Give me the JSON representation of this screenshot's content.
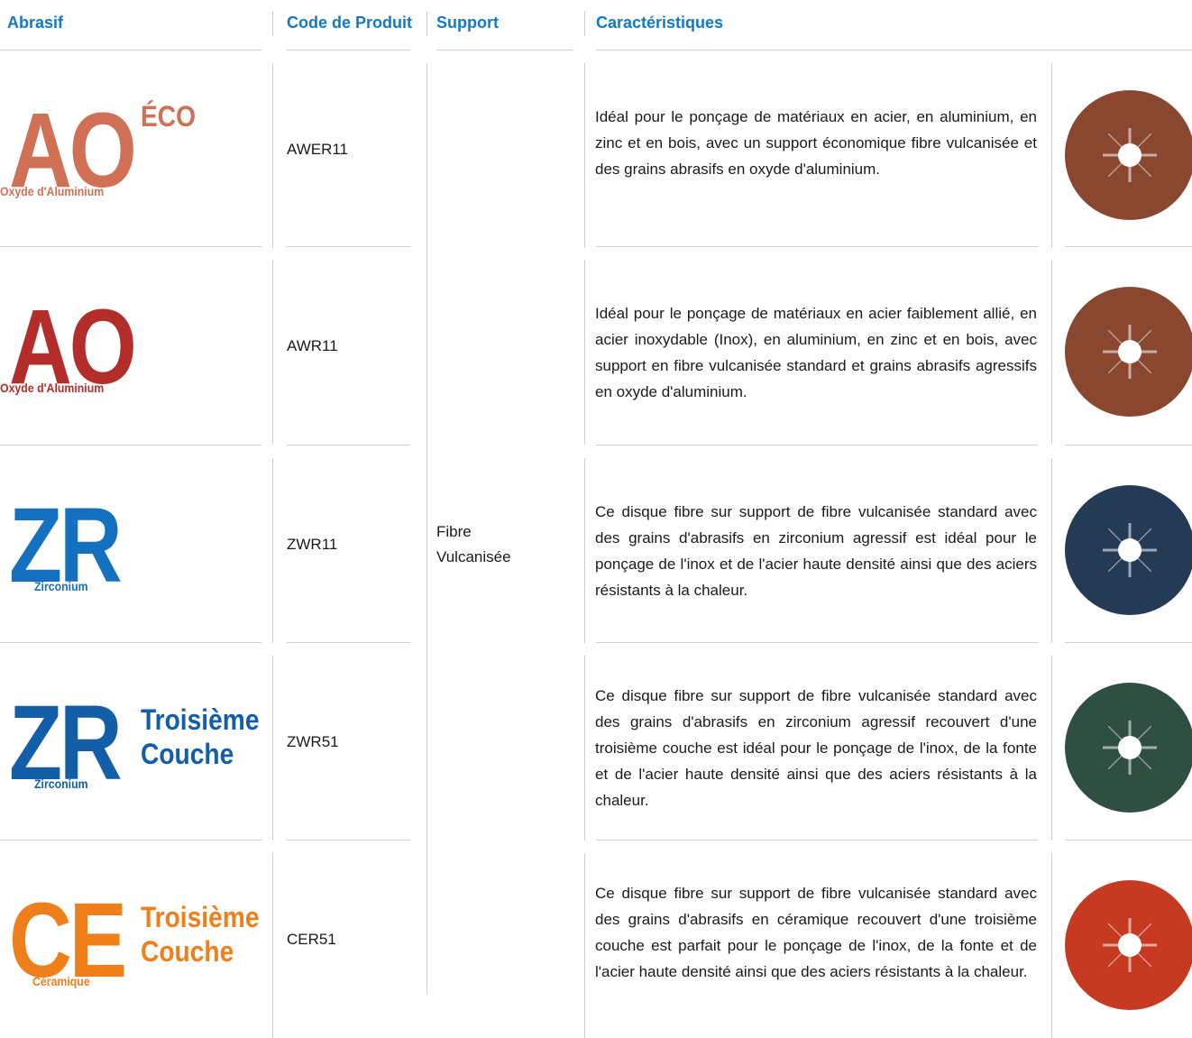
{
  "header": {
    "abrasif": "Abrasif",
    "code": "Code de Produit",
    "support": "Support",
    "caracteristiques": "Caractéristiques"
  },
  "support_value": "Fibre\nVulcanisée",
  "rows": [
    {
      "logo": "AO",
      "logo_sub": "Oxyde d'Aluminium",
      "logo_side": "ÉCO",
      "color": "#d07055",
      "code": "AWER11",
      "description": "Idéal pour le ponçage de matériaux en acier, en aluminium, en zinc et en bois, avec un support économique fibre vulcanisée et des grains abrasifs en oxyde d'aluminium.",
      "disc_color": "#8a4730"
    },
    {
      "logo": "AO",
      "logo_sub": "Oxyde d'Aluminium",
      "logo_side": "",
      "color": "#b32d2a",
      "code": "AWR11",
      "description": "Idéal pour le ponçage de matériaux en acier faiblement allié, en acier inoxydable (Inox), en aluminium, en zinc et en bois, avec support en fibre vulcanisée standard et grains abrasifs agressifs en oxyde d'aluminium.",
      "disc_color": "#8a4730"
    },
    {
      "logo": "ZR",
      "logo_sub": "Zirconium",
      "logo_side": "",
      "color": "#1570c0",
      "code": "ZWR11",
      "description": "Ce disque fibre sur support de fibre vulcanisée standard avec des grains d'abrasifs en zirconium agressif est idéal pour le ponçage de l'inox et de l'acier haute densité ainsi que des aciers résistants à la chaleur.",
      "disc_color": "#243a55"
    },
    {
      "logo": "ZR",
      "logo_sub": "Zirconium",
      "logo_side": "Troisième\nCouche",
      "color": "#125ea8",
      "code": "ZWR51",
      "description": "Ce disque fibre sur support de fibre vulcanisée standard avec des grains d'abrasifs en zirconium agressif recouvert d'une troisième couche est idéal pour le ponçage de l'inox, de la fonte et de l'acier haute densité ainsi que des aciers résistants à la chaleur.",
      "disc_color": "#2f4f42"
    },
    {
      "logo": "CE",
      "logo_sub": "Céramique",
      "logo_side": "Troisième\nCouche",
      "color": "#ef7f1a",
      "code": "CER51",
      "description": "Ce disque fibre sur support de fibre vulcanisée standard avec des grains d'abrasifs en céramique recouvert d'une troisième couche est parfait pour le ponçage de l'inox, de la fonte et de l'acier haute densité ainsi que des aciers résistants à la chaleur.",
      "disc_color": "#c63a22"
    }
  ]
}
